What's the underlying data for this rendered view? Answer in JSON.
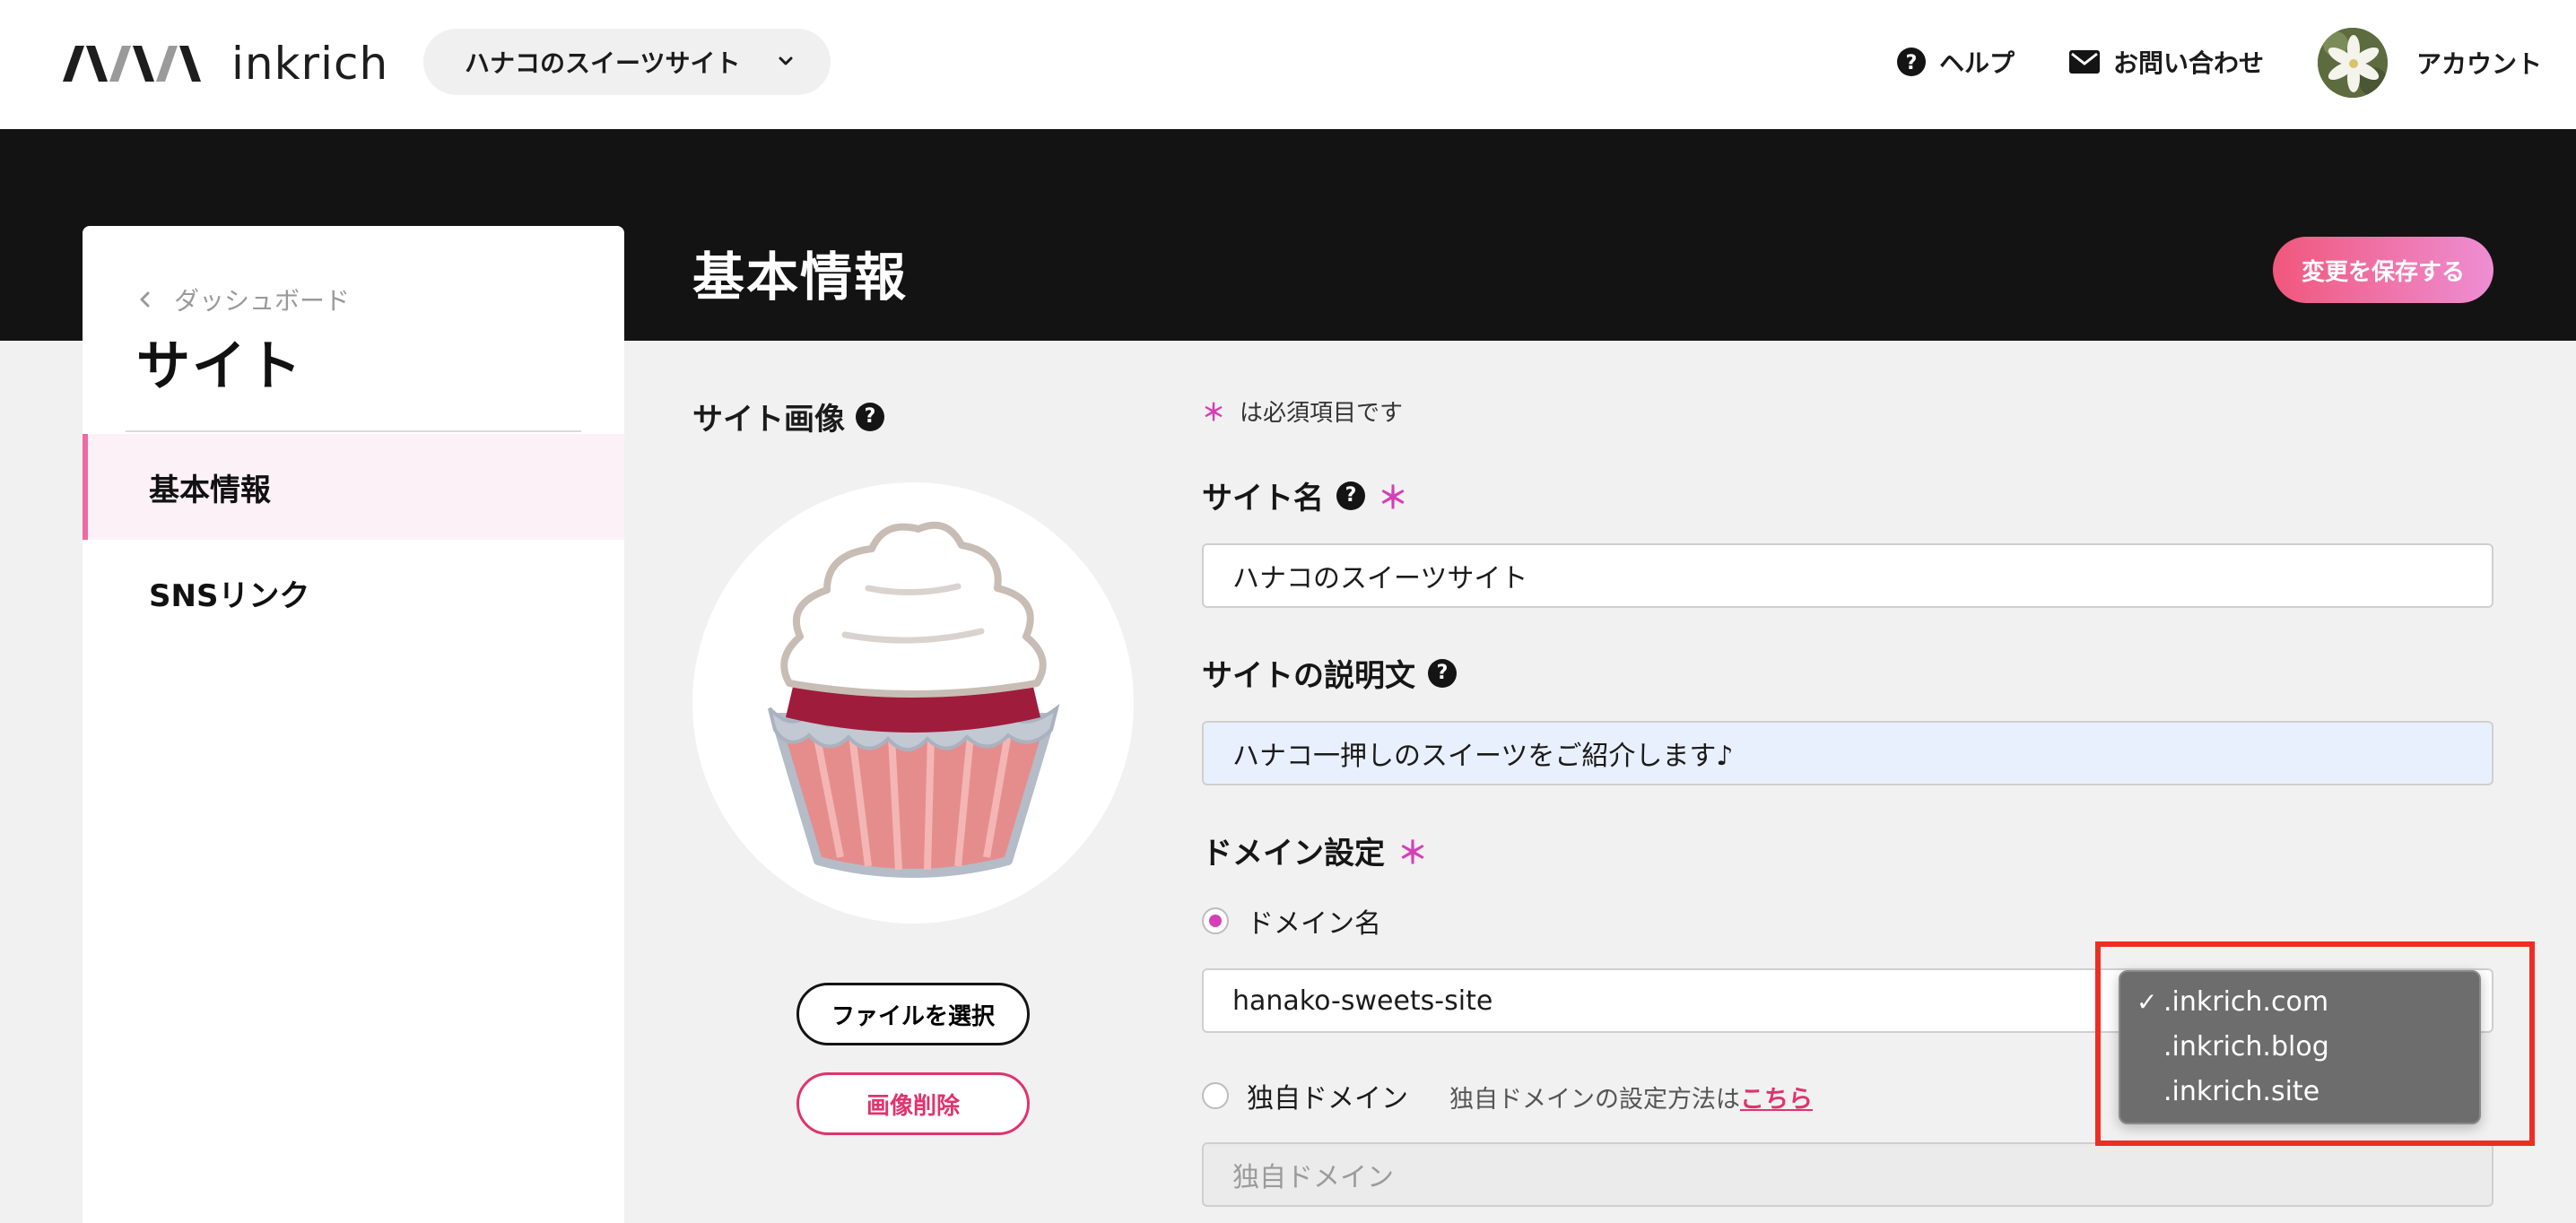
{
  "header": {
    "logo_text": "inkrich",
    "site_selector": "ハナコのスイーツサイト",
    "help_label": "ヘルプ",
    "contact_label": "お問い合わせ",
    "account_label": "アカウント"
  },
  "page": {
    "title": "基本情報",
    "save_label": "変更を保存する"
  },
  "sidebar": {
    "back_label": "ダッシュボード",
    "title": "サイト",
    "items": [
      {
        "label": "基本情報",
        "active": true
      },
      {
        "label": "SNSリンク",
        "active": false
      }
    ]
  },
  "image_section": {
    "label": "サイト画像",
    "help_icon": "?",
    "choose_file_label": "ファイルを選択",
    "delete_label": "画像削除"
  },
  "form": {
    "required_star": "＊",
    "required_note": "は必須項目です",
    "site_name_label": "サイト名",
    "site_name_value": "ハナコのスイーツサイト",
    "description_label": "サイトの説明文",
    "description_value": "ハナコ一押しのスイーツをご紹介します♪",
    "domain_label": "ドメイン設定",
    "domain_option_label": "ドメイン名",
    "domain_value": "hanako-sweets-site",
    "custom_domain_label": "独自ドメイン",
    "custom_domain_hint": "独自ドメインの設定方法は",
    "custom_domain_link": "こちら",
    "custom_domain_placeholder": "独自ドメイン"
  },
  "domain_dropdown": {
    "options": [
      {
        "label": ".inkrich.com",
        "selected": true
      },
      {
        "label": ".inkrich.blog",
        "selected": false
      },
      {
        "label": ".inkrich.site",
        "selected": false
      }
    ],
    "check_mark": "✓"
  },
  "colors": {
    "accent_pink": "#d63fb7",
    "delete_red": "#e0336e",
    "save_gradient_start": "#f0577c",
    "save_gradient_end": "#ee8ed3",
    "highlight_red": "#ee2d24",
    "dark_band": "#131313"
  }
}
